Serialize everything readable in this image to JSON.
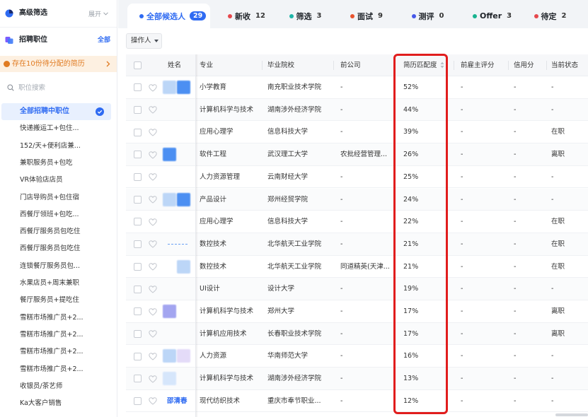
{
  "theme": {
    "accent": "#2f6bf2",
    "notice": "#e07b22",
    "highlight": "#e11d1d"
  },
  "sidebar": {
    "advanced_filter": {
      "title": "高级筛选",
      "expand_label": "展开"
    },
    "jobs": {
      "title": "招聘职位",
      "all_label": "全部",
      "notice": "存在10份待分配的简历",
      "search_placeholder": "职位搜索",
      "items": [
        {
          "label": "全部招聘中职位",
          "selected": true
        },
        {
          "label": "快递搬运工+包住..."
        },
        {
          "label": "152/天+便利店兼..."
        },
        {
          "label": "兼职服务员+包吃"
        },
        {
          "label": "VR体验店店员"
        },
        {
          "label": "门店导购员+包住宿"
        },
        {
          "label": "西餐厅领班+包吃..."
        },
        {
          "label": "西餐厅服务员包吃住"
        },
        {
          "label": "西餐厅服务员包吃住"
        },
        {
          "label": "连锁餐厅服务员包..."
        },
        {
          "label": "水果店员+周末兼职"
        },
        {
          "label": "餐厅服务员+提吃住"
        },
        {
          "label": "雪糕市场推广员+2..."
        },
        {
          "label": "雪糕市场推广员+2..."
        },
        {
          "label": "雪糕市场推广员+2..."
        },
        {
          "label": "雪糕市场推广员+2..."
        },
        {
          "label": "收银员/茶艺师"
        },
        {
          "label": "Ka大客户销售"
        }
      ]
    }
  },
  "tabs": [
    {
      "label": "全部候选人",
      "count": 29,
      "dot_color": "#2f6bf2",
      "active": true
    },
    {
      "label": "新收",
      "count": 12,
      "dot_color": "#e5484d"
    },
    {
      "label": "筛选",
      "count": 3,
      "dot_color": "#1fb5a8"
    },
    {
      "label": "面试",
      "count": 9,
      "dot_color": "#e8542f"
    },
    {
      "label": "测评",
      "count": 0,
      "dot_color": "#4657e8"
    },
    {
      "label": "Offer",
      "count": 3,
      "dot_color": "#18b38f"
    },
    {
      "label": "待定",
      "count": 2,
      "dot_color": "#e5484d"
    }
  ],
  "toolbar": {
    "operator_label": "操作人"
  },
  "table": {
    "columns": {
      "name": "姓名",
      "major": "专业",
      "school": "毕业院校",
      "prev_company": "前公司",
      "match": "简历匹配度",
      "employer_rating": "前雇主评分",
      "credit": "信用分",
      "status": "当前状态"
    },
    "rows": [
      {
        "major": "小学教育",
        "school": "南充职业技术学院",
        "prev_company": "-",
        "match": "52%",
        "employer_rating": "-",
        "credit": "-",
        "status": "-"
      },
      {
        "major": "计算机科学与技术",
        "school": "湖南涉外经济学院",
        "prev_company": "-",
        "match": "44%",
        "employer_rating": "-",
        "credit": "-",
        "status": "-"
      },
      {
        "major": "应用心理学",
        "school": "信息科技大学",
        "prev_company": "-",
        "match": "39%",
        "employer_rating": "-",
        "credit": "-",
        "status": "在职"
      },
      {
        "major": "软件工程",
        "school": "武汉理工大学",
        "prev_company": "农批经营管理...",
        "match": "26%",
        "employer_rating": "-",
        "credit": "-",
        "status": "离职"
      },
      {
        "major": "人力资源管理",
        "school": "云南财经大学",
        "prev_company": "-",
        "match": "25%",
        "employer_rating": "-",
        "credit": "-",
        "status": "-"
      },
      {
        "major": "产品设计",
        "school": "郑州经贸学院",
        "prev_company": "-",
        "match": "24%",
        "employer_rating": "-",
        "credit": "-",
        "status": "-"
      },
      {
        "major": "应用心理学",
        "school": "信息科技大学",
        "prev_company": "-",
        "match": "22%",
        "employer_rating": "-",
        "credit": "-",
        "status": "在职"
      },
      {
        "major": "数控技术",
        "school": "北华航天工业学院",
        "prev_company": "-",
        "match": "21%",
        "employer_rating": "-",
        "credit": "-",
        "status": "在职"
      },
      {
        "major": "数控技术",
        "school": "北华航天工业学院",
        "prev_company": "同道精英(天津...",
        "match": "21%",
        "employer_rating": "-",
        "credit": "-",
        "status": "在职"
      },
      {
        "major": "UI设计",
        "school": "设计大学",
        "prev_company": "-",
        "match": "19%",
        "employer_rating": "-",
        "credit": "-",
        "status": "-"
      },
      {
        "major": "计算机科学与技术",
        "school": "郑州大学",
        "prev_company": "-",
        "match": "17%",
        "employer_rating": "-",
        "credit": "-",
        "status": "离职"
      },
      {
        "major": "计算机应用技术",
        "school": "长春职业技术学院",
        "prev_company": "-",
        "match": "17%",
        "employer_rating": "-",
        "credit": "-",
        "status": "离职"
      },
      {
        "major": "人力资源",
        "school": "华南师范大学",
        "prev_company": "-",
        "match": "16%",
        "employer_rating": "-",
        "credit": "-",
        "status": "-"
      },
      {
        "major": "计算机科学与技术",
        "school": "湖南涉外经济学院",
        "prev_company": "-",
        "match": "13%",
        "employer_rating": "-",
        "credit": "-",
        "status": "-"
      },
      {
        "name": "邵清春",
        "major": "现代纺织技术",
        "school": "重庆市奉节职业...",
        "prev_company": "-",
        "match": "12%",
        "employer_rating": "-",
        "credit": "-",
        "status": "-"
      }
    ]
  }
}
